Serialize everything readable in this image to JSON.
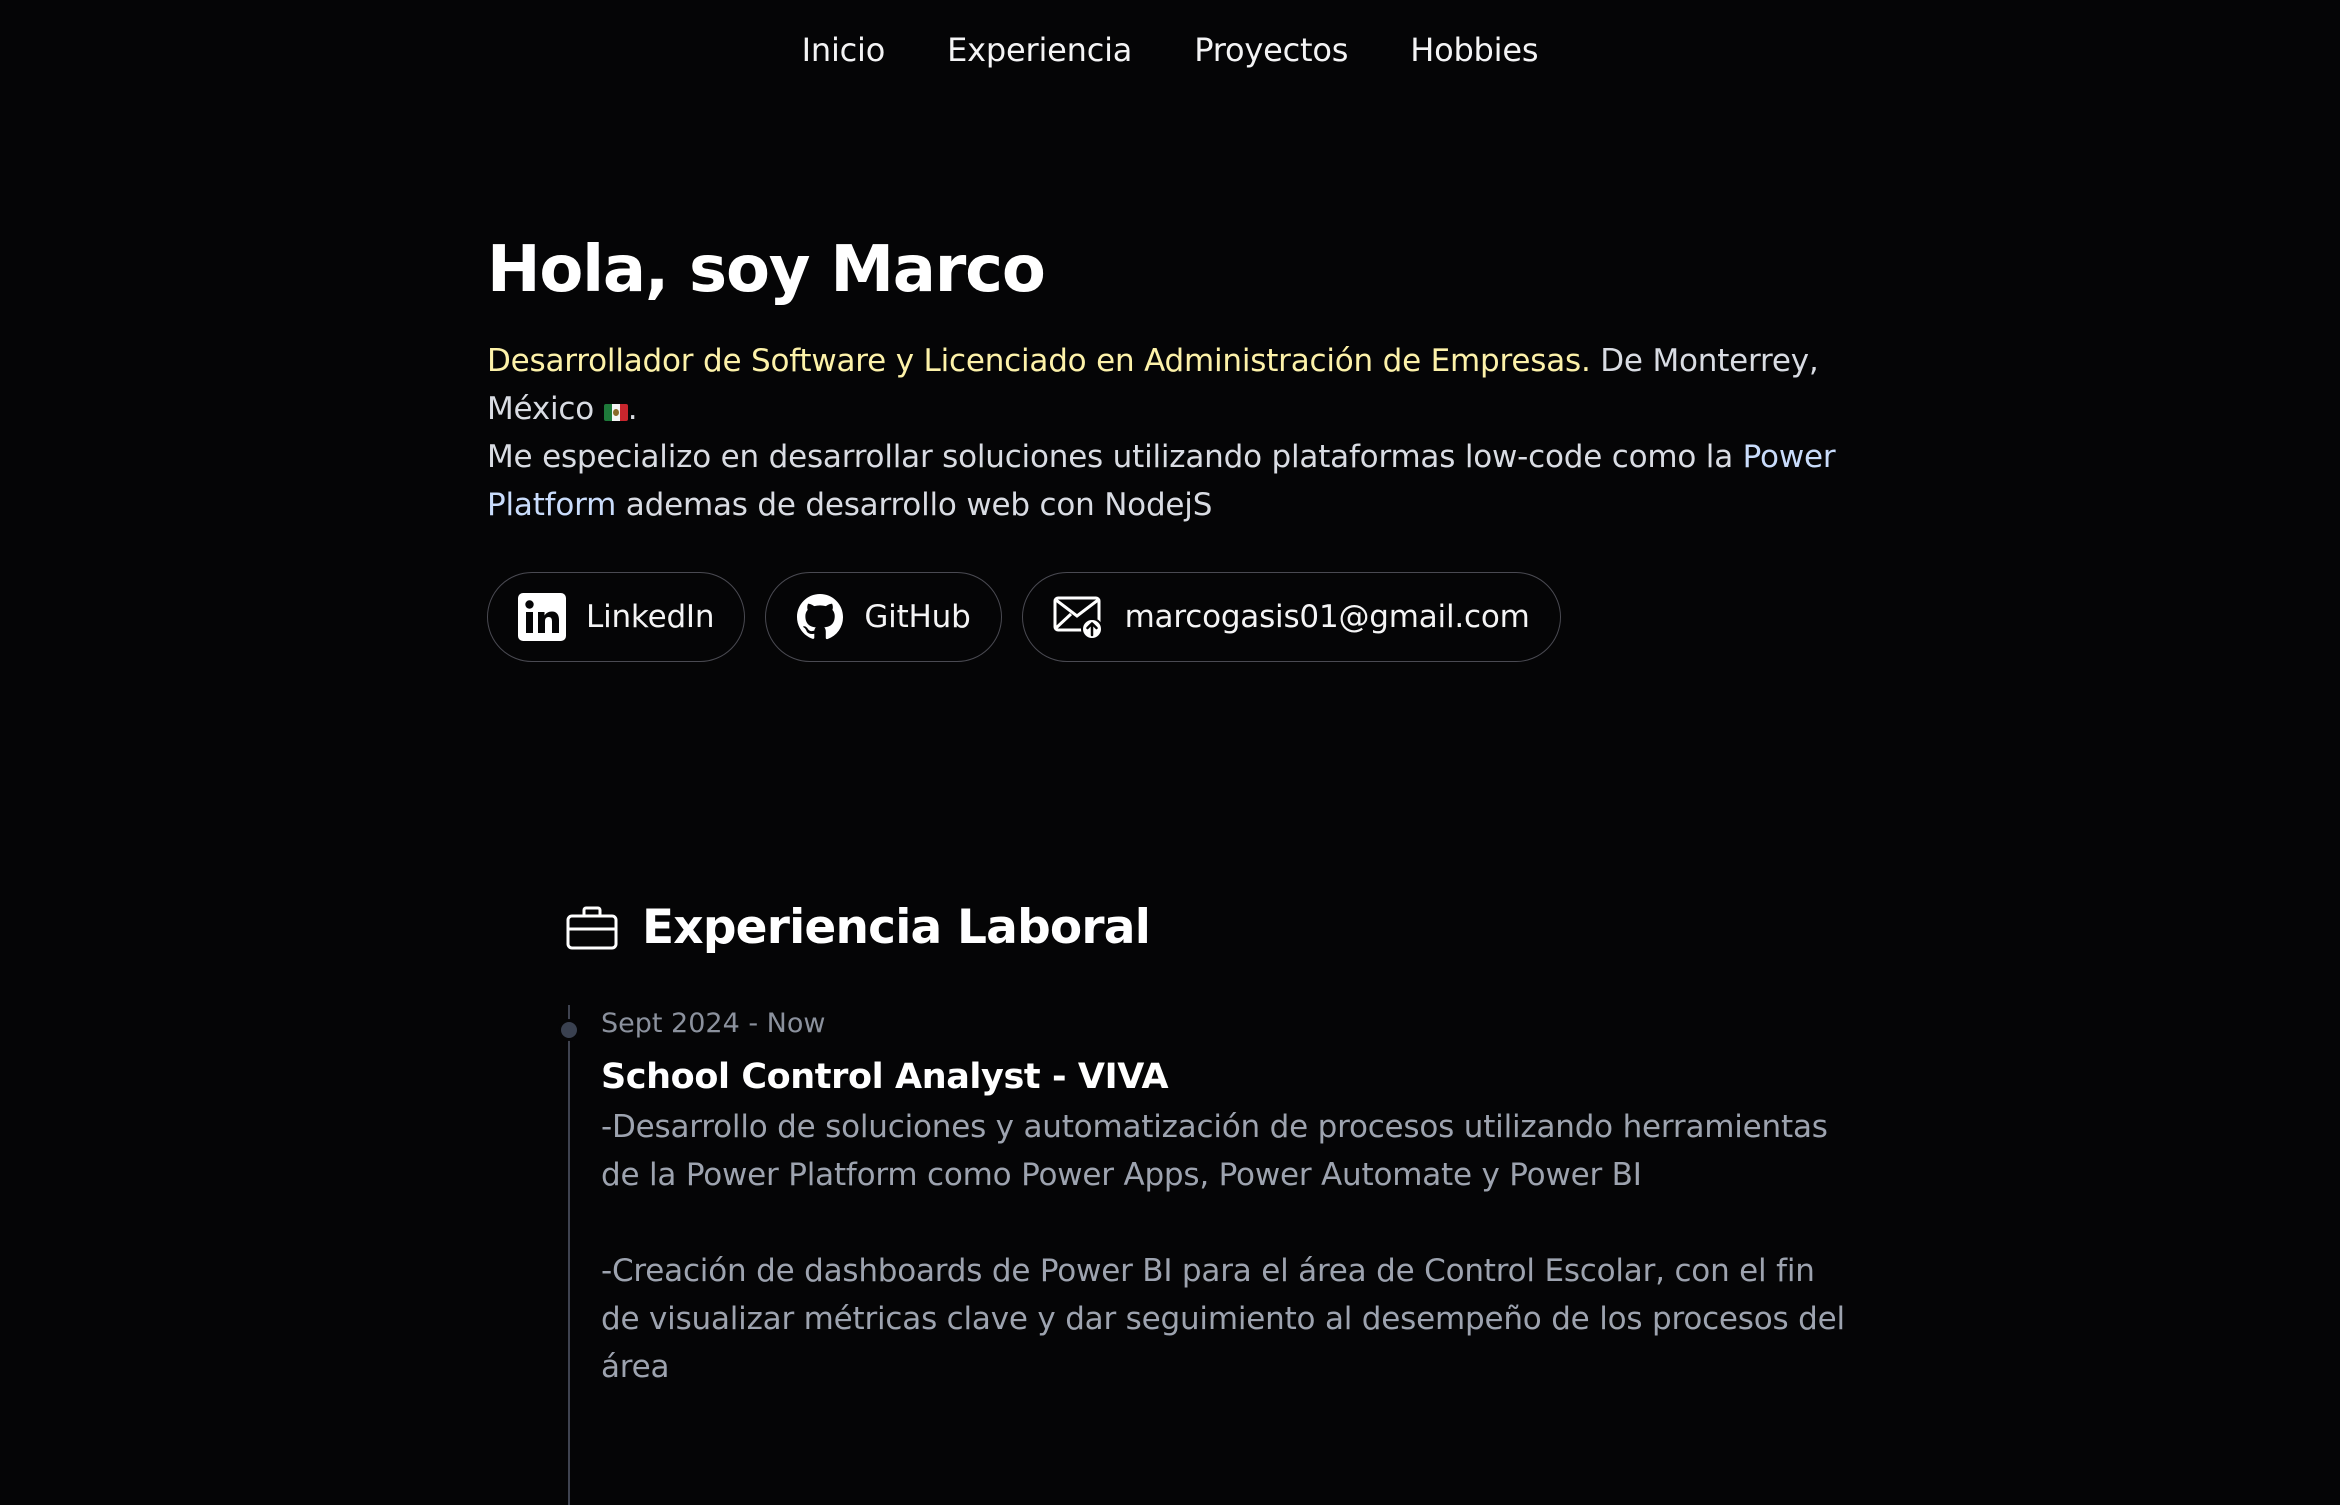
{
  "nav": {
    "items": [
      {
        "label": "Inicio"
      },
      {
        "label": "Experiencia"
      },
      {
        "label": "Proyectos"
      },
      {
        "label": "Hobbies"
      }
    ]
  },
  "hero": {
    "title": "Hola, soy Marco",
    "desc": {
      "role": "Desarrollador de Software y Licenciado en Administración de Empresas.",
      "location": " De Monterrey, México ",
      "flag": "mexico-flag",
      "period": ".",
      "specialty_prefix": "Me especializo en desarrollar soluciones utilizando plataformas low-code como la ",
      "power_platform": "Power Platform",
      "specialty_suffix": " ademas de desarrollo web con NodejS"
    },
    "links": {
      "linkedin": {
        "label": "LinkedIn",
        "icon": "linkedin-icon"
      },
      "github": {
        "label": "GitHub",
        "icon": "github-icon"
      },
      "email": {
        "label": "marcogasis01@gmail.com",
        "icon": "mail-icon"
      }
    }
  },
  "experience": {
    "title": "Experiencia Laboral",
    "icon": "briefcase-icon",
    "jobs": [
      {
        "date": "Sept 2024 - Now",
        "role": "School Control Analyst - VIVA",
        "paragraphs": [
          "-Desarrollo de soluciones y automatización de procesos utilizando herramientas de la Power Platform como Power Apps, Power Automate y Power BI",
          "-Creación de dashboards de Power BI para el área de Control Escolar, con el fin de visualizar métricas clave y dar seguimiento al desempeño de los procesos del área"
        ]
      }
    ]
  },
  "colors": {
    "background": "#050506",
    "highlight_yellow": "#fdf2a9",
    "highlight_blue": "#c9dcfb",
    "muted_text": "#9da3af"
  }
}
